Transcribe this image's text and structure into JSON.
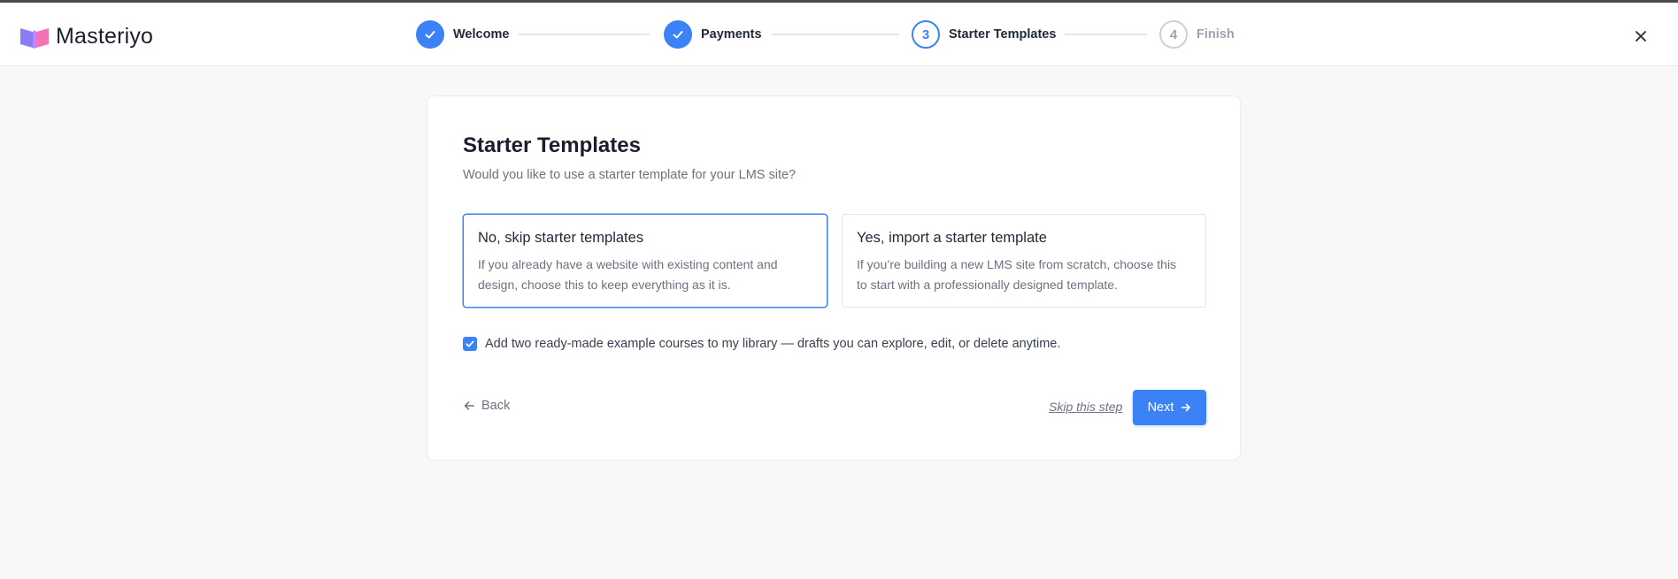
{
  "brand": {
    "name": "Masteriyo",
    "logo_colors": [
      "#8b7cf6",
      "#f472b6"
    ]
  },
  "colors": {
    "accent": "#3b82f6",
    "muted": "#6b7280"
  },
  "stepper": {
    "steps": [
      {
        "label": "Welcome",
        "state": "done",
        "number": "1"
      },
      {
        "label": "Payments",
        "state": "done",
        "number": "2"
      },
      {
        "label": "Starter Templates",
        "state": "active",
        "number": "3"
      },
      {
        "label": "Finish",
        "state": "pending",
        "number": "4"
      }
    ]
  },
  "header": {
    "close_icon": "close-icon"
  },
  "card": {
    "title": "Starter Templates",
    "subtitle": "Would you like to use a starter template for your LMS site?",
    "options": [
      {
        "title": "No, skip starter templates",
        "description": "If you already have a website with existing content and design, choose this to keep everything as it is.",
        "selected": true
      },
      {
        "title": "Yes, import a starter template",
        "description": "If you’re building a new LMS site from scratch, choose this to start with a professionally designed template.",
        "selected": false
      }
    ],
    "checkbox": {
      "label": "Add two ready-made example courses to my library — drafts you can explore, edit, or delete anytime.",
      "checked": true
    },
    "back_label": "Back",
    "skip_label": "Skip this step",
    "next_label": "Next"
  }
}
